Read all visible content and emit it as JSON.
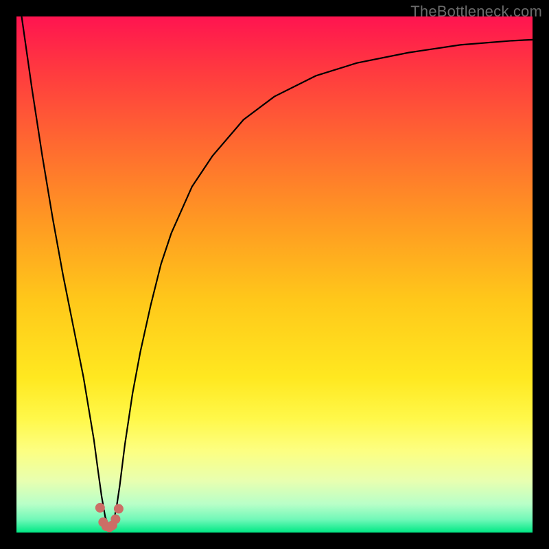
{
  "watermark": "TheBottleneck.com",
  "chart_data": {
    "type": "line",
    "title": "",
    "xlabel": "",
    "ylabel": "",
    "xlim": [
      0,
      100
    ],
    "ylim": [
      0,
      100
    ],
    "grid": false,
    "legend": false,
    "background_gradient": {
      "stops": [
        {
          "offset": 0.0,
          "color": "#ff1450"
        },
        {
          "offset": 0.1,
          "color": "#ff3840"
        },
        {
          "offset": 0.25,
          "color": "#ff6a30"
        },
        {
          "offset": 0.4,
          "color": "#ff9a22"
        },
        {
          "offset": 0.55,
          "color": "#ffc81a"
        },
        {
          "offset": 0.7,
          "color": "#ffe820"
        },
        {
          "offset": 0.78,
          "color": "#fff84a"
        },
        {
          "offset": 0.84,
          "color": "#fdff80"
        },
        {
          "offset": 0.9,
          "color": "#e8ffb0"
        },
        {
          "offset": 0.945,
          "color": "#b8ffc8"
        },
        {
          "offset": 0.975,
          "color": "#70f8b8"
        },
        {
          "offset": 1.0,
          "color": "#00e884"
        }
      ]
    },
    "series": [
      {
        "name": "bottleneck-curve",
        "color": "#000000",
        "width": 2.2,
        "x": [
          1.0,
          3.0,
          5.0,
          7.0,
          9.0,
          11.0,
          13.0,
          14.0,
          15.0,
          15.8,
          16.5,
          17.2,
          18.0,
          18.6,
          19.0,
          19.4,
          20.0,
          21.0,
          22.5,
          24.0,
          26.0,
          28.0,
          30.0,
          34.0,
          38.0,
          44.0,
          50.0,
          58.0,
          66.0,
          76.0,
          86.0,
          96.0,
          100.0
        ],
        "y": [
          100.0,
          86.0,
          73.0,
          61.0,
          50.0,
          40.0,
          30.0,
          24.0,
          18.0,
          12.0,
          7.0,
          3.0,
          1.0,
          1.5,
          3.0,
          5.0,
          9.0,
          17.0,
          27.0,
          35.0,
          44.0,
          52.0,
          58.0,
          67.0,
          73.0,
          80.0,
          84.5,
          88.5,
          91.0,
          93.0,
          94.5,
          95.3,
          95.5
        ]
      }
    ],
    "markers": [
      {
        "name": "valley-marker",
        "color": "#cc6e66",
        "size": 14,
        "x": [
          16.2,
          16.8,
          17.4,
          18.0,
          18.6,
          19.2,
          19.8
        ],
        "y": [
          4.8,
          2.0,
          1.2,
          1.0,
          1.4,
          2.6,
          4.6
        ]
      }
    ]
  }
}
